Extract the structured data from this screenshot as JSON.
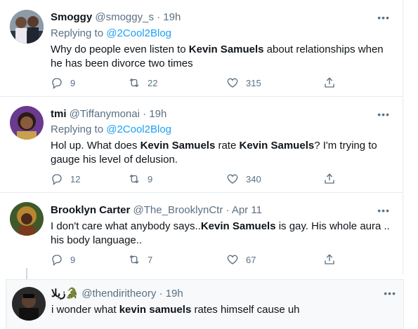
{
  "tweets": [
    {
      "name": "Smoggy",
      "handle": "@smoggy_s",
      "time": "· 19h",
      "replying_to_label": "Replying to ",
      "replying_to_handle": "@2Cool2Blog",
      "text_parts": [
        "Why do people even listen to ",
        "Kevin Samuels",
        " about relationships when he has been divorce two times"
      ],
      "replies": "9",
      "retweets": "22",
      "likes": "315",
      "more": "•••"
    },
    {
      "name": "tmi",
      "handle": "@Tiffanymonai",
      "time": "· 19h",
      "replying_to_label": "Replying to ",
      "replying_to_handle": "@2Cool2Blog",
      "text_parts": [
        "Hol up. What does ",
        "Kevin Samuels",
        " rate ",
        "Kevin Samuels",
        "? I'm trying to gauge his level of delusion."
      ],
      "replies": "12",
      "retweets": "9",
      "likes": "340",
      "more": "•••"
    },
    {
      "name": "Brooklyn Carter",
      "handle": "@The_BrooklynCtr",
      "time": "· Apr 11",
      "text_parts": [
        "I don't care what anybody says..",
        "Kevin Samuels",
        " is gay. His whole aura .. his body language.."
      ],
      "replies": "9",
      "retweets": "7",
      "likes": "67",
      "more": "•••"
    },
    {
      "name": "زيلا",
      "name_emoji": "🐊",
      "handle": "@thendiritheory",
      "time": "· 19h",
      "text_parts": [
        "i wonder what ",
        "kevin samuels",
        " rates himself cause uh"
      ],
      "more": "•••"
    }
  ],
  "colors": {
    "link": "#1da1f2",
    "muted": "#5b7083",
    "text": "#0f1419",
    "border": "#e6ecf0"
  }
}
